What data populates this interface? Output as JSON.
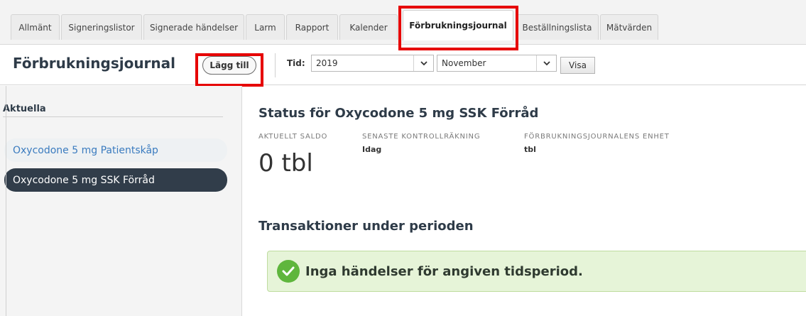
{
  "tabs": [
    {
      "label": "Allmänt"
    },
    {
      "label": "Signeringslistor"
    },
    {
      "label": "Signerade händelser"
    },
    {
      "label": "Larm"
    },
    {
      "label": "Rapport"
    },
    {
      "label": "Kalender"
    },
    {
      "label": "Förbrukningsjournal",
      "active": true
    },
    {
      "label": "Beställningslista"
    },
    {
      "label": "Mätvärden"
    }
  ],
  "toolbar": {
    "title": "Förbrukningsjournal",
    "add_label": "Lägg till",
    "tid_label": "Tid:",
    "year_value": "2019",
    "month_value": "November",
    "show_label": "Visa"
  },
  "sidebar": {
    "heading": "Aktuella",
    "items": [
      {
        "label": "Oxycodone 5 mg Patientskåp",
        "active": false
      },
      {
        "label": "Oxycodone 5 mg SSK Förråd",
        "active": true
      }
    ]
  },
  "main": {
    "title": "Status för Oxycodone 5 mg SSK Förråd",
    "saldo_label": "AKTUELLT SALDO",
    "saldo_value": "0 tbl",
    "kontroll_label": "SENASTE KONTROLLRÄKNING",
    "kontroll_value": "Idag",
    "enhet_label": "FÖRBRUKNINGSJOURNALENS ENHET",
    "enhet_value": "tbl",
    "transactions_title": "Transaktioner under perioden",
    "empty_message": "Inga händelser för angiven tidsperiod."
  },
  "colors": {
    "highlight": "#e60000",
    "active_item_bg": "#313d4a",
    "link_blue": "#3a7bbf",
    "success_green": "#5fb63d"
  },
  "icons": {
    "select_chevron": "chevron-down-icon",
    "alert": "check-circle-icon"
  }
}
